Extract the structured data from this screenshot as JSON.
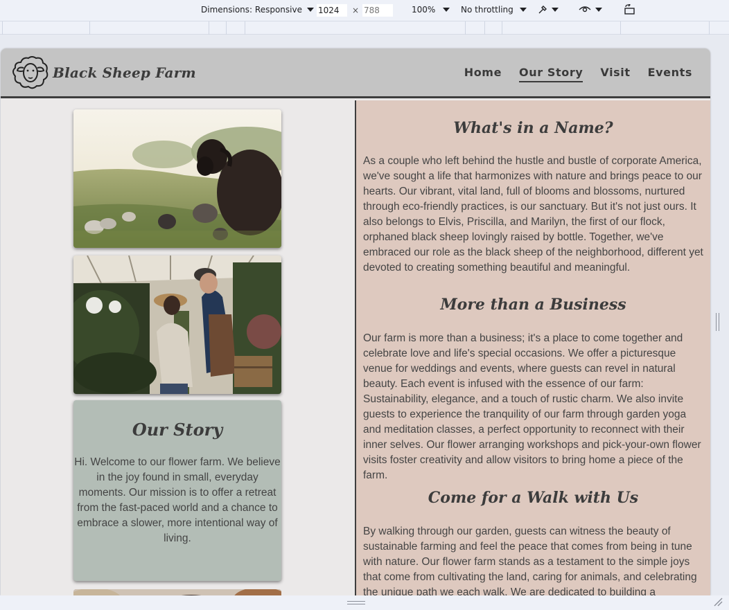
{
  "devtools": {
    "dimensions_label": "Dimensions: Responsive",
    "width_value": "1024",
    "height_value": "788",
    "times": "×",
    "zoom_label": "100%",
    "throttle_label": "No throttling"
  },
  "icons": [
    "caret-down-icon",
    "eyedropper-icon",
    "eye-icon",
    "rotate-icon",
    "sheep-logo-icon"
  ],
  "colors": {
    "header_bg": "#c4c4c4",
    "left_bg": "#ebe9e9",
    "right_bg": "#dec9bf",
    "card_bg": "#b3bdb6",
    "text": "#444444"
  },
  "site": {
    "logo_text": "Black Sheep Farm",
    "nav": [
      {
        "label": "Home",
        "active": false
      },
      {
        "label": "Our Story",
        "active": true
      },
      {
        "label": "Visit",
        "active": false
      },
      {
        "label": "Events",
        "active": false
      }
    ]
  },
  "story_card": {
    "title": "Our Story",
    "text": "Hi. Welcome to our flower farm. We believe in the joy found in small, everyday moments. Our mission is to offer a retreat from the fast-paced world and a chance to embrace a slower, more intentional way of living."
  },
  "sections": [
    {
      "title": "What's in a Name?",
      "text": "As a couple who left behind the hustle and bustle of corporate America, we've sought a life that harmonizes with nature and brings peace to our hearts. Our vibrant, vital land, full of blooms and blossoms, nurtured through eco-friendly practices, is our sanctuary. But it's not just ours. It also belongs to Elvis, Priscilla, and Marilyn, the first of our flock, orphaned black sheep lovingly raised by bottle. Together, we've embraced our role as the black sheep of the neighborhood, different yet devoted to creating something beautiful and meaningful."
    },
    {
      "title": "More than a Business",
      "text": "Our farm is more than a business; it's a place to come together and celebrate love and life's special occasions. We offer a picturesque venue for weddings and events, where guests can revel in natural beauty. Each event is infused with the essence of our farm: Sustainability, elegance, and a touch of rustic charm. We also invite guests to experience the tranquility of our farm through garden yoga and meditation classes, a perfect opportunity to reconnect with their inner selves. Our flower arranging workshops and pick-your-own flower visits foster creativity and allow visitors to bring home a piece of the farm."
    },
    {
      "title": "Come for a Walk with Us",
      "text": "By walking through our garden, guests can witness the beauty of sustainable farming and feel the peace that comes from being in tune with nature. Our flower farm stands as a testament to the simple joys that come from cultivating the land, caring for animals, and celebrating the unique path we each walk. We are dedicated to building a community that"
    }
  ]
}
